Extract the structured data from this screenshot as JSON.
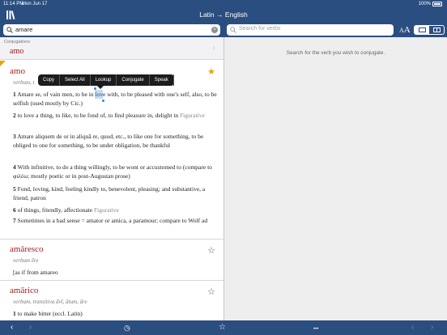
{
  "status": {
    "time": "11:14 PM",
    "date": "Mon Jun 17",
    "battery": "100%"
  },
  "nav": {
    "title": "Latin → English"
  },
  "search": {
    "value": "amare",
    "verb_placeholder": "Search for verbs",
    "clear": "×"
  },
  "display": {
    "font_small": "A",
    "font_big": "A"
  },
  "conjugation": {
    "label": "Conjugations",
    "word": "amo",
    "chevron": "›"
  },
  "edit_menu": {
    "items": [
      "Copy",
      "Select All",
      "Lookup",
      "Conjugate",
      "Speak"
    ]
  },
  "entries": [
    {
      "headword": "amo",
      "pos": "verbum, t",
      "starred": true,
      "star": "★",
      "senses": [
        {
          "num": "1",
          "text": "Amare se, of vain men, to be in love with, to be pleased with one's self, also, to be selfish (used mostly by Cic.)",
          "tag": ""
        },
        {
          "num": "2",
          "text": "to love a thing, to like, to be fond of, to find pleasure in, delight in",
          "tag": "Figurative"
        },
        {
          "num": "3",
          "text": "Amare aliquem de or in aliquā re, quod, etc., to like one for something, to be obliged to one for something, to be under obligation, be thankful",
          "tag": ""
        },
        {
          "num": "4",
          "text": "With infinitive, to do a thing willingly, to be wont or accustomed to (compare to φιλέω; mostly poetic or in post-Augustan prose)",
          "tag": ""
        },
        {
          "num": "5",
          "text": "Fond, loving, kind, feeling kindly to, benevolent, pleasing; and substantive, a friend, patron",
          "tag": ""
        },
        {
          "num": "6",
          "text": "of things, friendly, affectionate",
          "tag": "Figurative"
        },
        {
          "num": "7",
          "text": "Sometimes in a bad sense = amator or amica, a paramour; compare to Wolf ad",
          "tag": ""
        }
      ]
    },
    {
      "headword": "amāresco",
      "pos": "verbum ēre",
      "starred": false,
      "star": "☆",
      "senses": [
        {
          "num": "",
          "text": "[as if from amareo",
          "tag": ""
        }
      ]
    },
    {
      "headword": "amārico",
      "pos": "verbum, transitiva āvī, ātum, āre",
      "starred": false,
      "star": "☆",
      "senses": [
        {
          "num": "1",
          "text": "to make bitter (eccl. Latin)",
          "tag": ""
        }
      ]
    }
  ],
  "right_pane": {
    "hint": "Search for the verb you wish to conjugate."
  },
  "toolbar": {
    "back": "‹",
    "forward": "›",
    "history": "◷",
    "favorites": "☆",
    "more": "•••",
    "back_right": "‹",
    "forward_right": "›"
  },
  "colors": {
    "bar": "#2b4e80",
    "headword": "#a21c1c",
    "star_on": "#e6a400"
  }
}
